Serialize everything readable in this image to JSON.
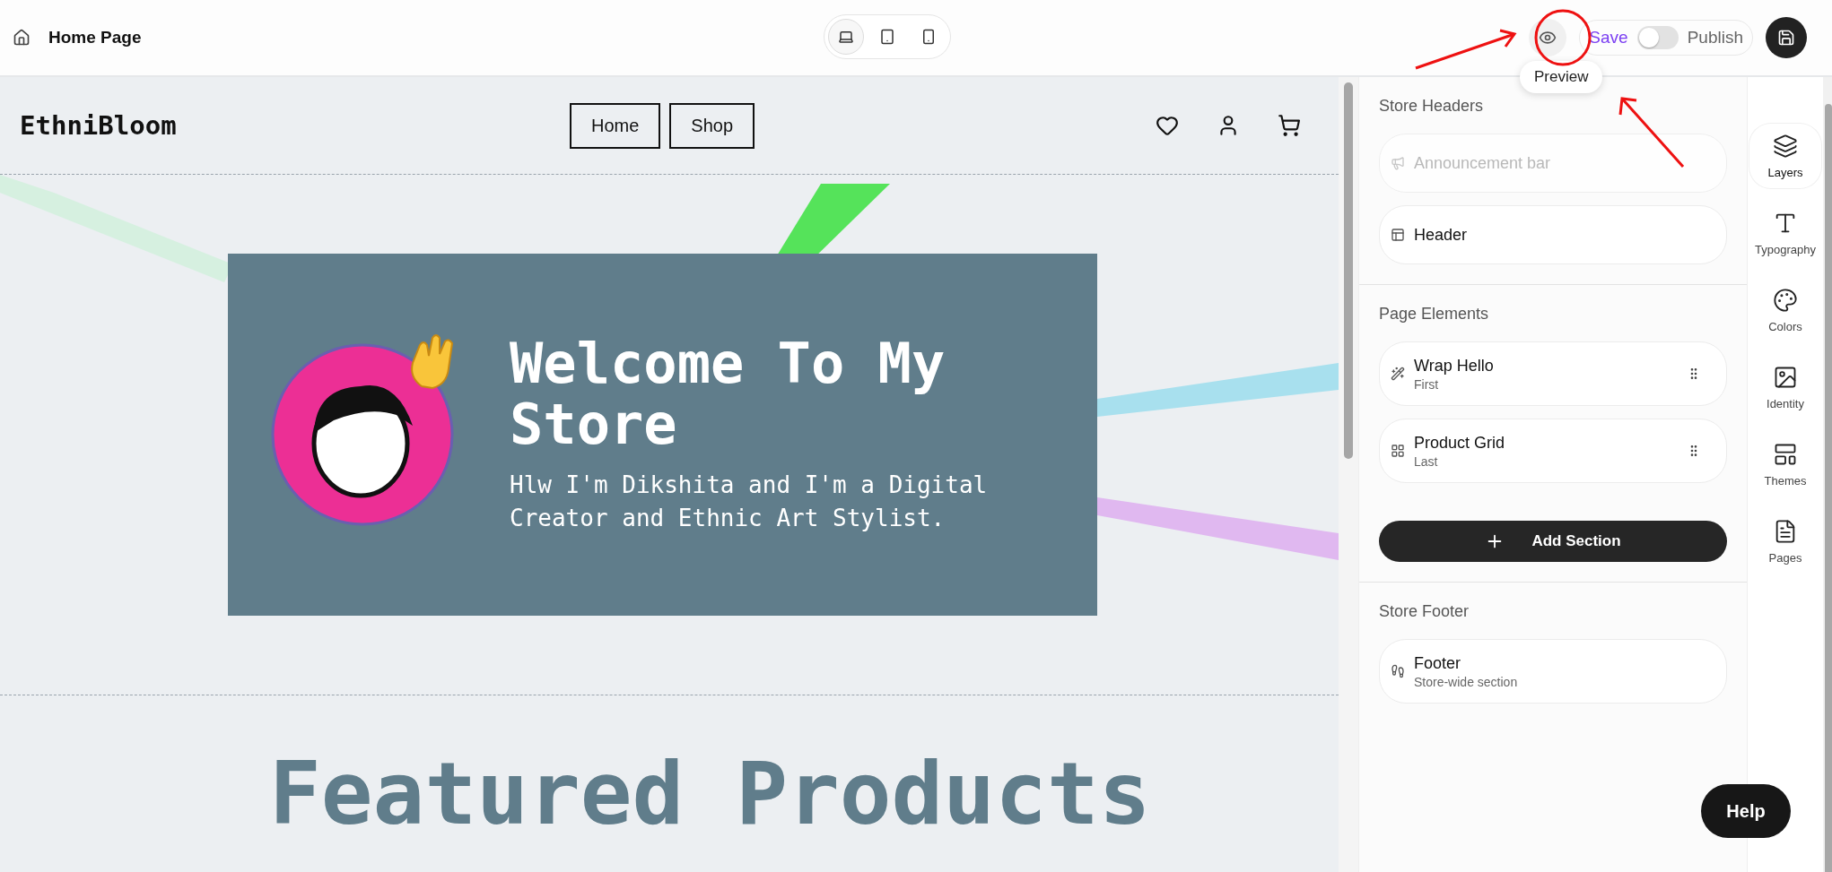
{
  "topbar": {
    "page_title": "Home Page",
    "devices": [
      {
        "kind": "desktop",
        "selected": true
      },
      {
        "kind": "tablet",
        "selected": false
      },
      {
        "kind": "mobile",
        "selected": false
      }
    ],
    "preview_tooltip": "Preview",
    "save": "Save",
    "publish_toggle": {
      "on": false
    },
    "publish": "Publish"
  },
  "store": {
    "logo": "EthniBloom",
    "nav": [
      "Home",
      "Shop"
    ],
    "hero": {
      "title": "Welcome To My Store",
      "subtitle": "Hlw I'm Dikshita and I'm a Digital Creator and Ethnic Art Stylist."
    },
    "featured_title": "Featured Products"
  },
  "panel": {
    "sections": [
      {
        "title": "Store Headers",
        "items": [
          {
            "kind": "announcement",
            "label": "Announcement bar",
            "disabled": true,
            "draggable": false
          },
          {
            "kind": "header",
            "label": "Header",
            "disabled": false,
            "draggable": false
          }
        ]
      },
      {
        "title": "Page Elements",
        "items": [
          {
            "kind": "wand",
            "label": "Wrap Hello",
            "sub": "First",
            "disabled": false,
            "draggable": true
          },
          {
            "kind": "grid",
            "label": "Product Grid",
            "sub": "Last",
            "disabled": false,
            "draggable": true
          }
        ],
        "add_button": "Add Section"
      },
      {
        "title": "Store Footer",
        "items": [
          {
            "kind": "footer",
            "label": "Footer",
            "sub": "Store-wide section",
            "disabled": false,
            "draggable": false
          }
        ]
      }
    ]
  },
  "rail": [
    {
      "kind": "layers",
      "label": "Layers",
      "selected": true
    },
    {
      "kind": "typography",
      "label": "Typography",
      "selected": false
    },
    {
      "kind": "colors",
      "label": "Colors",
      "selected": false
    },
    {
      "kind": "identity",
      "label": "Identity",
      "selected": false
    },
    {
      "kind": "themes",
      "label": "Themes",
      "selected": false
    },
    {
      "kind": "pages",
      "label": "Pages",
      "selected": false
    }
  ],
  "help": "Help"
}
